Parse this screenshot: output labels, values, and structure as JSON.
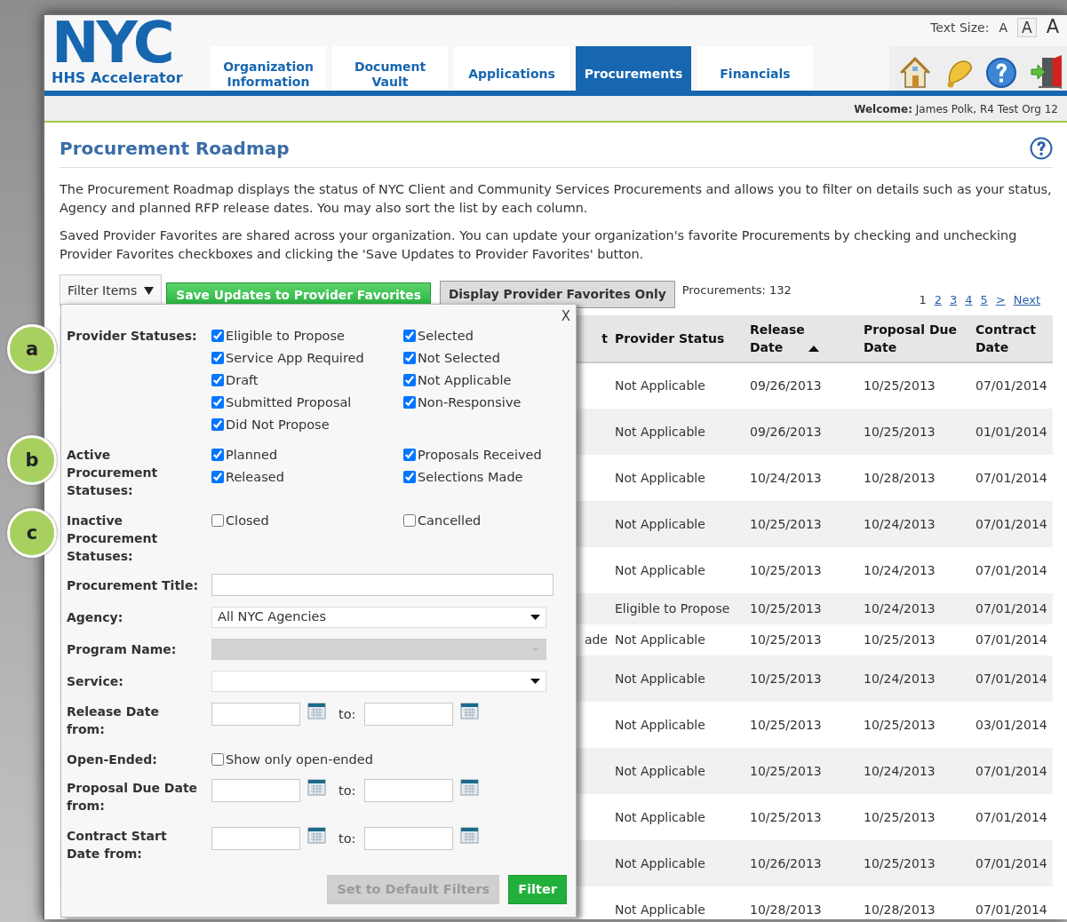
{
  "header": {
    "logo": "NYC",
    "logo_subtitle": "HHS Accelerator",
    "text_size": {
      "label": "Text Size:",
      "options": [
        {
          "label": "A",
          "selected": false
        },
        {
          "label": "A",
          "selected": true
        },
        {
          "label": "A",
          "selected": false
        }
      ]
    },
    "tabs": [
      {
        "label": "Organization Information",
        "selected": false
      },
      {
        "label": "Document Vault",
        "selected": false
      },
      {
        "label": "Applications",
        "selected": false
      },
      {
        "label": "Procurements",
        "selected": true
      },
      {
        "label": "Financials",
        "selected": false
      }
    ],
    "welcome": "**Welcome:** James Polk, R4 Test Org 12"
  },
  "page": {
    "title": "Procurement Roadmap",
    "paragraphs": [
      "The Procurement Roadmap displays the status of NYC Client and Community Services Procurements and allows you to filter on details such as your status, Agency and planned RFP release dates. You may also sort the list by each column.",
      "Saved Provider Favorites are shared across your organization. You can update your organization's favorite Procurements by checking and unchecking Provider Favorites checkboxes and clicking the 'Save Updates to Provider Favorites' button."
    ]
  },
  "toolbar": {
    "filter_button": "Filter Items",
    "save_button": "Save Updates to Provider Favorites",
    "display_button": "Display Provider Favorites Only",
    "count": "Procurements: 132",
    "pager": [
      {
        "label": "1",
        "selected": true
      },
      {
        "label": "2",
        "selected": false
      },
      {
        "label": "3",
        "selected": false
      },
      {
        "label": "4",
        "selected": false
      },
      {
        "label": "5",
        "selected": false
      },
      {
        "label": ">",
        "selected": false
      },
      {
        "label": "Next",
        "selected": false
      }
    ]
  },
  "table": {
    "columns": [
      {
        "label": "t",
        "sorted": false
      },
      {
        "label": "Provider Status",
        "sorted": false
      },
      {
        "label": "Release Date",
        "sorted": true
      },
      {
        "label": "Proposal Due Date",
        "sorted": false
      },
      {
        "label": "Contract Date",
        "sorted": false
      }
    ],
    "rows": [
      [
        "",
        "Not Applicable",
        "09/26/2013",
        "10/25/2013",
        "07/01/2014"
      ],
      [
        "",
        "Not Applicable",
        "09/26/2013",
        "10/25/2013",
        "01/01/2014"
      ],
      [
        "",
        "Not Applicable",
        "10/24/2013",
        "10/28/2013",
        "07/01/2014"
      ],
      [
        "",
        "Not Applicable",
        "10/25/2013",
        "10/24/2013",
        "07/01/2014"
      ],
      [
        "",
        "Not Applicable",
        "10/25/2013",
        "10/24/2013",
        "07/01/2014"
      ],
      [
        "",
        "Eligible to Propose",
        "10/25/2013",
        "10/24/2013",
        "07/01/2014"
      ],
      [
        "ade",
        "Not Applicable",
        "10/25/2013",
        "10/25/2013",
        "07/01/2014"
      ],
      [
        "",
        "Not Applicable",
        "10/25/2013",
        "10/24/2013",
        "07/01/2014"
      ],
      [
        "",
        "Not Applicable",
        "10/25/2013",
        "10/25/2013",
        "03/01/2014"
      ],
      [
        "",
        "Not Applicable",
        "10/25/2013",
        "10/24/2013",
        "07/01/2014"
      ],
      [
        "",
        "Not Applicable",
        "10/25/2013",
        "10/25/2013",
        "07/01/2014"
      ],
      [
        "",
        "Not Applicable",
        "10/26/2013",
        "10/25/2013",
        "07/01/2014"
      ],
      [
        "",
        "Not Applicable",
        "10/28/2013",
        "10/28/2013",
        "07/01/2014"
      ]
    ]
  },
  "filter_panel": {
    "close": "X",
    "fields": [
      {
        "kind": "checkboxes",
        "label": "Provider Statuses:",
        "options": [
          {
            "label": "Eligible to Propose",
            "checked": true
          },
          {
            "label": "Selected",
            "checked": true
          },
          {
            "label": "Service App Required",
            "checked": true
          },
          {
            "label": "Not Selected",
            "checked": true
          },
          {
            "label": "Draft",
            "checked": true
          },
          {
            "label": "Not Applicable",
            "checked": true
          },
          {
            "label": "Submitted Proposal",
            "checked": true
          },
          {
            "label": "Non-Responsive",
            "checked": true
          },
          {
            "label": "Did Not Propose",
            "checked": true
          }
        ]
      },
      {
        "kind": "checkboxes",
        "label": "Active\nProcurement\nStatuses:",
        "options": [
          {
            "label": "Planned",
            "checked": true
          },
          {
            "label": "Proposals Received",
            "checked": true
          },
          {
            "label": "Released",
            "checked": true
          },
          {
            "label": "Selections Made",
            "checked": true
          }
        ]
      },
      {
        "kind": "checkboxes",
        "label": "Inactive\nProcurement\nStatuses:",
        "options": [
          {
            "label": "Closed",
            "checked": false
          },
          {
            "label": "Cancelled",
            "checked": false
          }
        ]
      },
      {
        "kind": "text",
        "label": "Procurement Title:"
      },
      {
        "kind": "select",
        "label": "Agency:",
        "value": "All NYC Agencies",
        "disabled": false
      },
      {
        "kind": "select",
        "label": "Program Name:",
        "disabled": true
      },
      {
        "kind": "select",
        "label": "Service:",
        "disabled": false
      },
      {
        "kind": "date_range",
        "label": "Release Date\nfrom:",
        "to_label": "to:"
      },
      {
        "kind": "single_checkbox",
        "label": "Open-Ended:",
        "options": [
          {
            "label": "Show only open-ended",
            "checked": false
          }
        ]
      },
      {
        "kind": "date_range",
        "label": "Proposal Due Date\nfrom:",
        "to_label": "to:"
      },
      {
        "kind": "date_range",
        "label": "Contract Start\nDate from:",
        "to_label": "to:"
      }
    ],
    "buttons": [
      {
        "label": "Set to Default Filters",
        "disabled": true
      },
      {
        "label": "Filter",
        "disabled": false
      }
    ]
  },
  "callouts": [
    {
      "label": "a"
    },
    {
      "label": "b"
    },
    {
      "label": "c"
    }
  ]
}
